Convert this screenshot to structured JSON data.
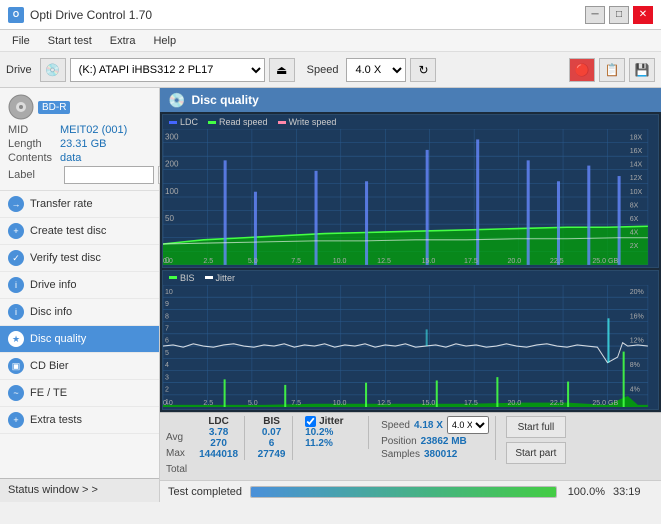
{
  "titlebar": {
    "title": "Opti Drive Control 1.70",
    "minimize": "─",
    "maximize": "□",
    "close": "✕"
  },
  "menubar": {
    "items": [
      "File",
      "Start test",
      "Extra",
      "Help"
    ]
  },
  "toolbar": {
    "drive_label": "Drive",
    "drive_value": "(K:) ATAPI iHBS312  2 PL17",
    "speed_label": "Speed",
    "speed_value": "4.0 X"
  },
  "disc": {
    "type": "BD-R",
    "mid_label": "MID",
    "mid_value": "MEIT02 (001)",
    "length_label": "Length",
    "length_value": "23.31 GB",
    "contents_label": "Contents",
    "contents_value": "data",
    "label_label": "Label"
  },
  "nav": {
    "items": [
      {
        "id": "transfer-rate",
        "label": "Transfer rate",
        "active": false
      },
      {
        "id": "create-test-disc",
        "label": "Create test disc",
        "active": false
      },
      {
        "id": "verify-test-disc",
        "label": "Verify test disc",
        "active": false
      },
      {
        "id": "drive-info",
        "label": "Drive info",
        "active": false
      },
      {
        "id": "disc-info",
        "label": "Disc info",
        "active": false
      },
      {
        "id": "disc-quality",
        "label": "Disc quality",
        "active": true
      },
      {
        "id": "cd-bier",
        "label": "CD Bier",
        "active": false
      },
      {
        "id": "fe-te",
        "label": "FE / TE",
        "active": false
      },
      {
        "id": "extra-tests",
        "label": "Extra tests",
        "active": false
      }
    ]
  },
  "content": {
    "header": "Disc quality",
    "chart_top": {
      "legend": [
        "LDC",
        "Read speed",
        "Write speed"
      ],
      "y_right_labels": [
        "18X",
        "16X",
        "14X",
        "12X",
        "10X",
        "8X",
        "6X",
        "4X",
        "2X"
      ],
      "y_left_labels": [
        "300",
        "",
        "200",
        "",
        "100",
        "",
        "50",
        "",
        "0"
      ],
      "x_labels": [
        "0.0",
        "2.5",
        "5.0",
        "7.5",
        "10.0",
        "12.5",
        "15.0",
        "17.5",
        "20.0",
        "22.5",
        "25.0 GB"
      ]
    },
    "chart_bottom": {
      "legend": [
        "BIS",
        "Jitter"
      ],
      "y_left_labels": [
        "10",
        "9",
        "8",
        "7",
        "6",
        "5",
        "4",
        "3",
        "2",
        "1"
      ],
      "y_right_labels": [
        "20%",
        "16%",
        "12%",
        "8%",
        "4%"
      ],
      "x_labels": [
        "0.0",
        "2.5",
        "5.0",
        "7.5",
        "10.0",
        "12.5",
        "15.0",
        "17.5",
        "20.0",
        "22.5",
        "25.0 GB"
      ]
    }
  },
  "stats": {
    "ldc_label": "LDC",
    "bis_label": "BIS",
    "jitter_label": "Jitter",
    "jitter_checked": true,
    "speed_label": "Speed",
    "speed_value": "4.18 X",
    "speed_select": "4.0 X",
    "avg_label": "Avg",
    "ldc_avg": "3.78",
    "bis_avg": "0.07",
    "jitter_avg": "10.2%",
    "max_label": "Max",
    "ldc_max": "270",
    "bis_max": "6",
    "jitter_max": "11.2%",
    "total_label": "Total",
    "ldc_total": "1444018",
    "bis_total": "27749",
    "position_label": "Position",
    "position_value": "23862 MB",
    "samples_label": "Samples",
    "samples_value": "380012",
    "btn_start_full": "Start full",
    "btn_start_part": "Start part"
  },
  "statusbar": {
    "status_text": "Test completed",
    "progress_pct": "100.0%",
    "time": "33:19",
    "status_window_label": "Status window > >"
  }
}
